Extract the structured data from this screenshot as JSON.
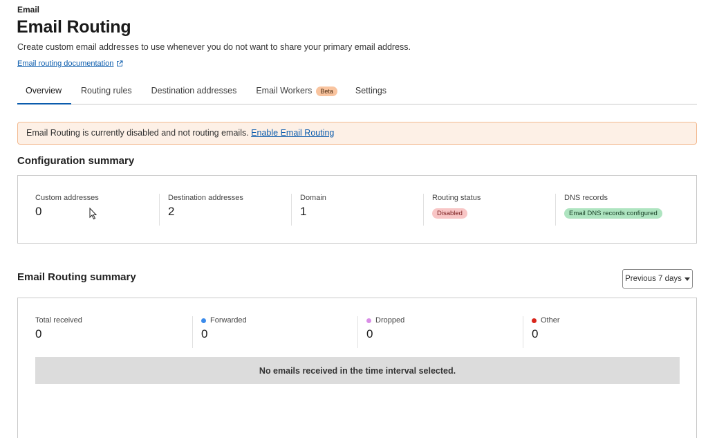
{
  "breadcrumb": "Email",
  "page": {
    "title": "Email Routing",
    "description": "Create custom email addresses to use whenever you do not want to share your primary email address.",
    "doc_link": "Email routing documentation",
    "doc_link_icon": "external-link-icon"
  },
  "tabs": [
    {
      "label": "Overview",
      "active": true
    },
    {
      "label": "Routing rules"
    },
    {
      "label": "Destination addresses"
    },
    {
      "label": "Email Workers",
      "badge": "Beta"
    },
    {
      "label": "Settings"
    }
  ],
  "alert": {
    "text": "Email Routing is currently disabled and not routing emails. ",
    "link": "Enable Email Routing"
  },
  "config": {
    "title": "Configuration summary",
    "custom_addresses": {
      "label": "Custom addresses",
      "value": "0"
    },
    "destination_addresses": {
      "label": "Destination addresses",
      "value": "2"
    },
    "domain": {
      "label": "Domain",
      "value": "1"
    },
    "routing_status": {
      "label": "Routing status",
      "badge": "Disabled"
    },
    "dns_records": {
      "label": "DNS records",
      "badge": "Email DNS records configured"
    }
  },
  "summary": {
    "title": "Email Routing summary",
    "period": "Previous 7 days",
    "total": {
      "label": "Total received",
      "value": "0"
    },
    "forwarded": {
      "label": "Forwarded",
      "value": "0",
      "color": "#3b8beb"
    },
    "dropped": {
      "label": "Dropped",
      "value": "0",
      "color": "#d98ee6"
    },
    "other": {
      "label": "Other",
      "value": "0",
      "color": "#d9261c"
    },
    "empty_message": "No emails received in the time interval selected."
  },
  "colors": {
    "accent": "#0b5cad",
    "warning_bg": "#fdf0e6",
    "warning_border": "#f3b98f"
  }
}
